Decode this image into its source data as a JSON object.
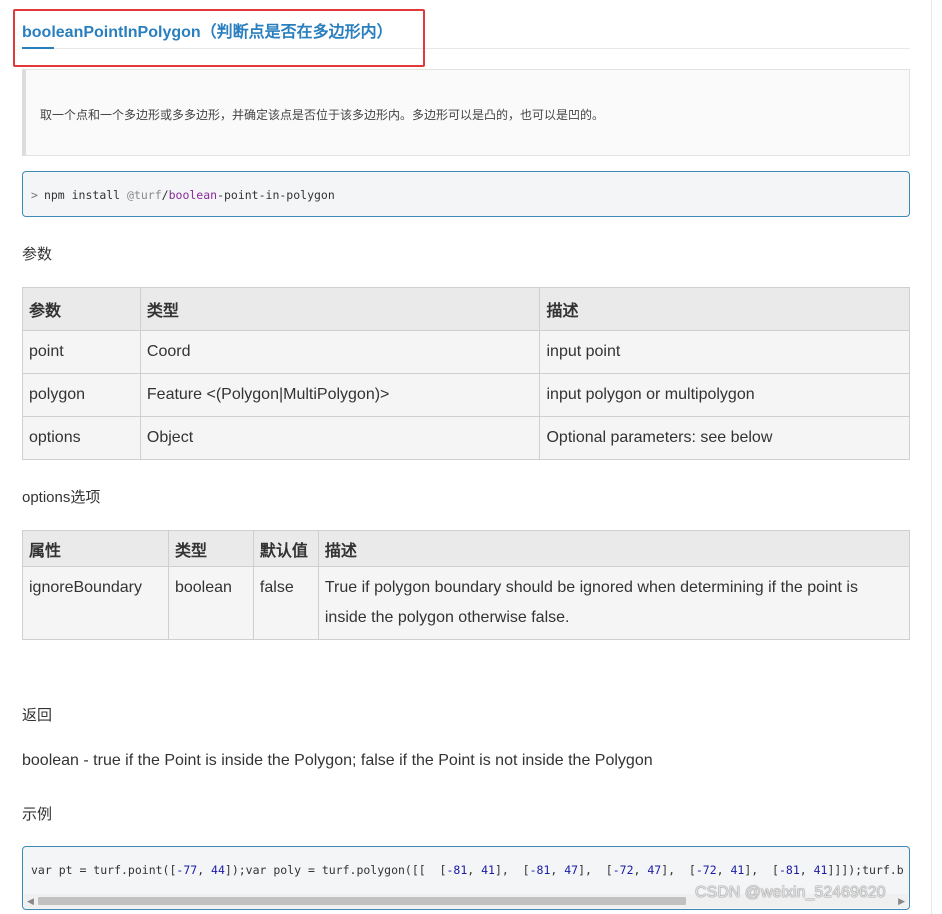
{
  "title": "booleanPointInPolygon（判断点是否在多边形内）",
  "description": "取一个点和一个多边形或多多边形，并确定该点是否位于该多边形内。多边形可以是凸的，也可以是凹的。",
  "npm": {
    "prompt": ">",
    "cmd_prefix": "npm install ",
    "scope": "@turf",
    "slash": "/",
    "kw": "boolean",
    "rest": "-point-in-polygon"
  },
  "params_heading": "参数",
  "params_table": {
    "headers": [
      "参数",
      "类型",
      "描述"
    ],
    "rows": [
      [
        "point",
        "Coord",
        "input point"
      ],
      [
        "polygon",
        "Feature <(Polygon|MultiPolygon)>",
        "input polygon or multipolygon"
      ],
      [
        "options",
        "Object",
        "Optional parameters: see below"
      ]
    ]
  },
  "options_heading": "options选项",
  "options_table": {
    "headers": [
      "属性",
      "类型",
      "默认值",
      "描述"
    ],
    "rows": [
      [
        "ignoreBoundary",
        "boolean",
        "false",
        "True if polygon boundary should be ignored when determining if the point is inside the polygon otherwise false."
      ]
    ]
  },
  "returns_heading": "返回",
  "returns_text": "boolean - true if the Point is inside the Polygon; false if the Point is not inside the Polygon",
  "example_heading": "示例",
  "code": {
    "p1": "var pt = turf.point([",
    "n1": "-77",
    "p2": ", ",
    "n2": "44",
    "p3": "]);var poly = turf.polygon([[  [",
    "n3": "-81",
    "p4": ", ",
    "n4": "41",
    "p5": "],  [",
    "n5": "-81",
    "p6": ", ",
    "n6": "47",
    "p7": "],  [",
    "n7": "-72",
    "p8": ", ",
    "n8": "47",
    "p9": "],  [",
    "n9": "-72",
    "p10": ", ",
    "n10": "41",
    "p11": "],  [",
    "n11": "-81",
    "p12": ", ",
    "n12": "41",
    "p13": "]]]);turf.b"
  },
  "watermark": "CSDN @weixin_52469620",
  "colors": {
    "accent": "#2a7fbf",
    "highlight": "#e23a3a",
    "code_border": "#3e89b8"
  }
}
